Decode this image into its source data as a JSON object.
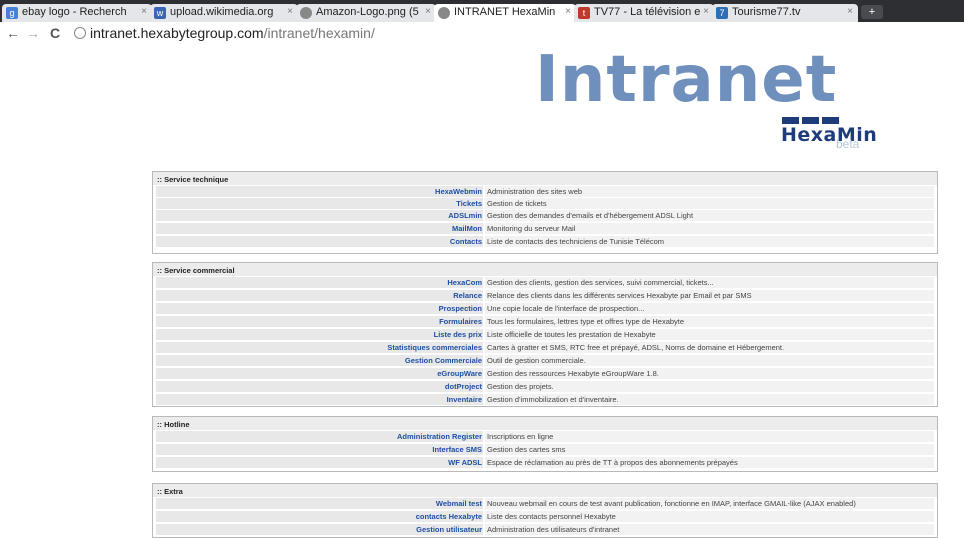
{
  "browser": {
    "tabs": [
      {
        "title": "ebay logo - Recherch",
        "icon": "google-icon"
      },
      {
        "title": "upload.wikimedia.org",
        "icon": "wikimedia-icon"
      },
      {
        "title": "Amazon-Logo.png (5",
        "icon": "globe-icon"
      },
      {
        "title": "INTRANET HexaMin",
        "icon": "globe-icon",
        "active": true
      },
      {
        "title": "TV77 - La télévision e",
        "icon": "tv77-icon"
      },
      {
        "title": "Tourisme77.tv",
        "icon": "tourisme77-icon"
      }
    ],
    "new_tab": "+",
    "nav": {
      "back": "←",
      "forward": "→",
      "reload": "C"
    },
    "url": {
      "host": "intranet.hexabytegroup.com",
      "path": "/intranet/hexamin/"
    }
  },
  "logo": {
    "word": "Intranet",
    "sub": "HexaMin",
    "badge": "beta",
    "color": "#6f8fbd",
    "dark": "#1e3c7a"
  },
  "sections": [
    {
      "title": ":: Service technique",
      "rows": [
        {
          "label": "HexaWebmin",
          "desc": "Administration des sites web"
        },
        {
          "label": "Tickets",
          "desc": "Gestion de tickets"
        },
        {
          "label": "ADSLmin",
          "desc": "Gestion des demandes d'emails et d'hébergement ADSL Light"
        },
        {
          "label": "MailMon",
          "desc": "Monitoring du serveur Mail"
        },
        {
          "label": "Contacts",
          "desc": "Liste de contacts des techniciens de Tunisie Télécom"
        }
      ]
    },
    {
      "title": ":: Service commercial",
      "rows": [
        {
          "label": "HexaCom",
          "desc": "Gestion des clients, gestion des services, suivi commercial, tickets..."
        },
        {
          "label": "Relance",
          "desc": "Relance des clients dans les différents services Hexabyte par Email et par SMS"
        },
        {
          "label": "Prospection",
          "desc": "Une copie locale de l'interface de prospection..."
        },
        {
          "label": "Formulaires",
          "desc": "Tous les formulaires, lettres type et offres type de Hexabyte"
        },
        {
          "label": "Liste des prix",
          "desc": "Liste officielle de toutes les prestation de Hexabyte"
        },
        {
          "label": "Statistiques commerciales",
          "desc": "Cartes à gratter et SMS, RTC free et prépayé, ADSL, Noms de domaine et Hébergement."
        },
        {
          "label": "Gestion Commerciale",
          "desc": "Outil de gestion commerciale."
        },
        {
          "label": "eGroupWare",
          "desc": "Gestion des ressources Hexabyte eGroupWare 1.8."
        },
        {
          "label": "dotProject",
          "desc": "Gestion des projets."
        },
        {
          "label": "Inventaire",
          "desc": "Gestion d'immobilization et d'inventaire."
        }
      ]
    },
    {
      "title": ":: Hotline",
      "rows": [
        {
          "label": "Administration Register",
          "desc": "Inscriptions en ligne"
        },
        {
          "label": "Interface SMS",
          "desc": "Gestion des cartes sms"
        },
        {
          "label": "WF ADSL",
          "desc": "Espace de réclamation au près de TT à propos des abonnements prépayés"
        }
      ]
    },
    {
      "title": ":: Extra",
      "rows": [
        {
          "label": "Webmail test",
          "desc": "Nouveau webmail en cours de test avant publication, fonctionne en IMAP, interface GMAIL-like (AJAX enabled)"
        },
        {
          "label": "contacts Hexabyte",
          "desc": "Liste des contacts personnel Hexabyte"
        },
        {
          "label": "Gestion utilisateur",
          "desc": "Administration des utilisateurs d'intranet"
        }
      ]
    }
  ]
}
